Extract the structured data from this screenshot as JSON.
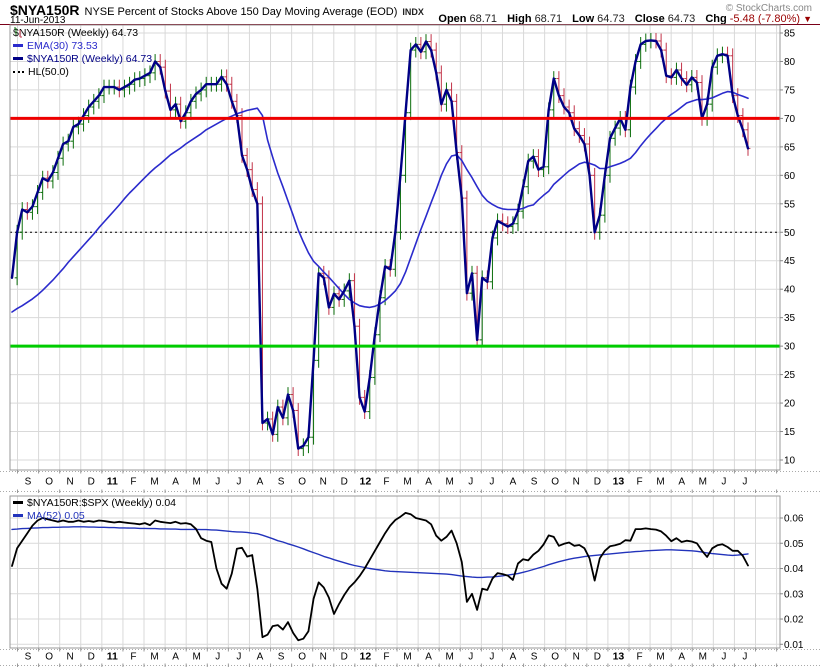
{
  "header": {
    "symbol": "$NYA150R",
    "description": "NYSE Percent of Stocks Above 150 Day Moving Average (EOD)",
    "index_tag": "INDX",
    "date": "11-Jun-2013",
    "copyright": "© StockCharts.com",
    "quote": {
      "open_label": "Open",
      "open": "68.71",
      "high_label": "High",
      "high": "68.71",
      "low_label": "Low",
      "low": "64.73",
      "close_label": "Close",
      "close": "64.73",
      "chg_label": "Chg",
      "chg": "-5.48 (-7.80%)",
      "chg_arrow": "▼"
    }
  },
  "legend_main": {
    "line1": "$NYA150R (Weekly) 64.73",
    "line2": "EMA(30) 73.53",
    "line3": "$NYA150R (Weekly) 64.73",
    "line4": "HL(50.0)"
  },
  "legend_indicator": {
    "line1": "$NYA150R:$SPX (Weekly) 0.04",
    "line2": "MA(52) 0.05"
  },
  "colors": {
    "grid": "#d9d9d9",
    "frame": "#999999",
    "axis_tick": "#888888",
    "red_hline": "#ee0000",
    "green_hline": "#00cc00",
    "hl_dashed": "#000000",
    "close_line": "#000085",
    "ema_line": "#2b2bcc",
    "bar_up": "#0b6e0b",
    "bar_down": "#c23348",
    "ratio_line": "#000000",
    "ma_line": "#2233bb",
    "strip_dots": "#aaaaaa"
  },
  "chart_data": [
    {
      "type": "line",
      "panel": "main",
      "title": "$NYA150R (Weekly)",
      "x_months": [
        "S",
        "O",
        "N",
        "D",
        "11",
        "F",
        "M",
        "A",
        "M",
        "J",
        "J",
        "A",
        "S",
        "O",
        "N",
        "D",
        "12",
        "F",
        "M",
        "A",
        "M",
        "J",
        "J",
        "A",
        "S",
        "O",
        "N",
        "D",
        "13",
        "F",
        "M",
        "A",
        "M",
        "J",
        "J"
      ],
      "ylim": [
        8,
        86.5
      ],
      "yticks": [
        85,
        80,
        75,
        70,
        65,
        60,
        55,
        50,
        45,
        40,
        35,
        30,
        25,
        20,
        15,
        10
      ],
      "grid": true,
      "legend_position": "top-left",
      "hlines": [
        {
          "value": 70,
          "color": "#ee0000",
          "width": 3,
          "style": "solid"
        },
        {
          "value": 50,
          "color": "#000000",
          "width": 1,
          "style": "dashed",
          "name": "HL(50.0)"
        },
        {
          "value": 30,
          "color": "#00cc00",
          "width": 3,
          "style": "solid"
        }
      ],
      "values": {
        "close": [
          42,
          50,
          54,
          53.5,
          54.5,
          57,
          59.5,
          59,
          60.5,
          63,
          65.5,
          66,
          68.5,
          69,
          70.5,
          72,
          73,
          74,
          75.5,
          75.5,
          75.5,
          75,
          75.5,
          76,
          76.8,
          77,
          77.5,
          78,
          80,
          79,
          74.8,
          71.5,
          72.5,
          69.5,
          71,
          73,
          74.3,
          75,
          76,
          76,
          76,
          77.3,
          76,
          73,
          70.5,
          63.5,
          61,
          57.5,
          55,
          16.5,
          17.2,
          14.5,
          19.3,
          17.4,
          21.5,
          18.7,
          12,
          12.5,
          14,
          27.5,
          42.8,
          42,
          36.8,
          39.2,
          38.2,
          39.7,
          41.5,
          33.5,
          21,
          18.5,
          24.5,
          32,
          38.5,
          44,
          43.5,
          50,
          60,
          71,
          82,
          83,
          81.7,
          83.5,
          82,
          78,
          72.5,
          75,
          73,
          64,
          56,
          39.3,
          42.8,
          31.1,
          42,
          41.3,
          49,
          52,
          51.5,
          51,
          51.5,
          53.7,
          58,
          62.5,
          63.3,
          61,
          61.5,
          71.5,
          77,
          74,
          72,
          71,
          68.2,
          67,
          65.5,
          60,
          50,
          53,
          60,
          66.5,
          68.3,
          70,
          68,
          75.5,
          80,
          83,
          83.6,
          83.7,
          83.6,
          82,
          77.5,
          77.2,
          78.5,
          77,
          75.9,
          77.2,
          76.3,
          70,
          72.5,
          79,
          81,
          81.3,
          81,
          74,
          70.5,
          68,
          64.73
        ],
        "ema30": [
          36,
          36.6,
          37.1,
          37.7,
          38.3,
          39,
          39.8,
          40.7,
          41.6,
          42.6,
          43.6,
          44.7,
          45.7,
          46.7,
          47.7,
          48.7,
          49.7,
          50.8,
          51.8,
          52.8,
          53.8,
          54.8,
          55.9,
          56.9,
          57.8,
          58.7,
          59.6,
          60.5,
          61.3,
          62,
          62.8,
          63.6,
          64.2,
          64.8,
          65.5,
          66.1,
          66.7,
          67.3,
          68,
          68.5,
          69,
          69.5,
          70,
          70.4,
          70.8,
          71.1,
          71.4,
          71.6,
          71.8,
          70.5,
          66.2,
          63.2,
          60.4,
          58,
          55.5,
          53,
          50.4,
          48.3,
          46.4,
          44.9,
          44,
          43,
          42.1,
          41.1,
          40.1,
          39.1,
          38.2,
          37.6,
          37.1,
          36.9,
          36.8,
          37,
          37.4,
          38,
          38.8,
          39.7,
          41,
          43,
          45.5,
          48,
          50.5,
          52.8,
          55.2,
          57.5,
          60,
          62,
          63.4,
          63.6,
          62.6,
          61,
          59.6,
          58,
          56.5,
          55.5,
          54.9,
          54.4,
          54.1,
          54,
          54,
          54,
          54.2,
          54.6,
          54.8,
          55.7,
          56.5,
          57.2,
          58.4,
          59.2,
          60,
          60.8,
          61.4,
          62,
          62.3,
          62.1,
          61.8,
          61.2,
          61.2,
          61.5,
          61.8,
          62.1,
          62.5,
          63,
          64,
          65.2,
          66.3,
          67.3,
          68.2,
          69.2,
          70,
          70.7,
          71.3,
          72,
          72.7,
          73,
          73.3,
          73.3,
          73.4,
          73.6,
          74,
          74.4,
          74.7,
          74.6,
          74.2,
          73.9,
          73.53
        ]
      },
      "series": [
        {
          "name": "$NYA150R (Weekly)",
          "last": 64.73,
          "type": "ohlc-bars",
          "data": "close"
        },
        {
          "name": "EMA(30)",
          "last": 73.53,
          "type": "line",
          "data": "ema30",
          "color": "#2b2bcc",
          "width": 1.6
        },
        {
          "name": "$NYA150R (Weekly)",
          "last": 64.73,
          "type": "line",
          "data": "close",
          "color": "#000085",
          "width": 2.4
        }
      ]
    },
    {
      "type": "line",
      "panel": "indicator",
      "title": "$NYA150R:$SPX (Weekly)",
      "x_months": [
        "S",
        "O",
        "N",
        "D",
        "11",
        "F",
        "M",
        "A",
        "M",
        "J",
        "J",
        "A",
        "S",
        "O",
        "N",
        "D",
        "12",
        "F",
        "M",
        "A",
        "M",
        "J",
        "J",
        "A",
        "S",
        "O",
        "N",
        "D",
        "13",
        "F",
        "M",
        "A",
        "M",
        "J",
        "J"
      ],
      "ylim": [
        0.0085,
        0.0685
      ],
      "yticks": [
        0.06,
        0.05,
        0.04,
        0.03,
        0.02,
        0.01
      ],
      "grid": true,
      "legend_position": "top-left",
      "values": {
        "ratio": [
          0.041,
          0.048,
          0.051,
          0.054,
          0.057,
          0.059,
          0.06,
          0.0595,
          0.059,
          0.0585,
          0.059,
          0.0585,
          0.0585,
          0.059,
          0.0585,
          0.0588,
          0.0585,
          0.059,
          0.0588,
          0.0585,
          0.0582,
          0.0585,
          0.0582,
          0.058,
          0.0578,
          0.0575,
          0.058,
          0.0572,
          0.059,
          0.0585,
          0.0582,
          0.058,
          0.0585,
          0.0578,
          0.058,
          0.0575,
          0.0557,
          0.052,
          0.051,
          0.0505,
          0.04,
          0.034,
          0.032,
          0.038,
          0.0478,
          0.0482,
          0.0447,
          0.0453,
          0.032,
          0.0128,
          0.0138,
          0.0172,
          0.0176,
          0.0158,
          0.0188,
          0.0145,
          0.0116,
          0.0122,
          0.0152,
          0.028,
          0.0345,
          0.0325,
          0.0285,
          0.022,
          0.026,
          0.0295,
          0.0325,
          0.0345,
          0.037,
          0.04,
          0.0435,
          0.047,
          0.0505,
          0.054,
          0.057,
          0.0592,
          0.0605,
          0.062,
          0.0615,
          0.06,
          0.0595,
          0.059,
          0.0575,
          0.053,
          0.051,
          0.0525,
          0.055,
          0.05,
          0.0426,
          0.0268,
          0.03,
          0.0236,
          0.032,
          0.0315,
          0.036,
          0.0382,
          0.0378,
          0.0372,
          0.0355,
          0.042,
          0.0437,
          0.0432,
          0.0455,
          0.047,
          0.0495,
          0.0531,
          0.0525,
          0.049,
          0.0498,
          0.0503,
          0.049,
          0.0493,
          0.048,
          0.044,
          0.0352,
          0.044,
          0.047,
          0.0488,
          0.0492,
          0.0498,
          0.0512,
          0.051,
          0.0556,
          0.0556,
          0.0559,
          0.0556,
          0.0554,
          0.0547,
          0.053,
          0.0508,
          0.052,
          0.0505,
          0.051,
          0.0507,
          0.05,
          0.047,
          0.0446,
          0.048,
          0.0492,
          0.0496,
          0.0485,
          0.047,
          0.047,
          0.045,
          0.0412
        ],
        "ma52": [
          0.0555,
          0.0556,
          0.0558,
          0.0559,
          0.056,
          0.0561,
          0.0562,
          0.0562,
          0.0563,
          0.0563,
          0.0564,
          0.0564,
          0.0565,
          0.0565,
          0.0565,
          0.0564,
          0.0564,
          0.0563,
          0.0563,
          0.0562,
          0.0562,
          0.0561,
          0.0561,
          0.056,
          0.056,
          0.0559,
          0.0559,
          0.0558,
          0.0558,
          0.0557,
          0.0557,
          0.0556,
          0.0556,
          0.0555,
          0.0555,
          0.0555,
          0.0555,
          0.0554,
          0.0554,
          0.0553,
          0.0552,
          0.055,
          0.0548,
          0.0546,
          0.0545,
          0.0544,
          0.0543,
          0.054,
          0.0538,
          0.0532,
          0.0525,
          0.0518,
          0.051,
          0.0505,
          0.0498,
          0.0492,
          0.0485,
          0.0478,
          0.047,
          0.0463,
          0.0456,
          0.0448,
          0.0442,
          0.0435,
          0.0429,
          0.0423,
          0.0417,
          0.0412,
          0.0408,
          0.0404,
          0.04,
          0.0397,
          0.0394,
          0.0391,
          0.0389,
          0.0388,
          0.0387,
          0.0386,
          0.0385,
          0.0384,
          0.0383,
          0.0382,
          0.0381,
          0.038,
          0.0379,
          0.0378,
          0.0376,
          0.0373,
          0.037,
          0.0368,
          0.0366,
          0.0365,
          0.0365,
          0.0366,
          0.0367,
          0.0369,
          0.0371,
          0.0374,
          0.0377,
          0.038,
          0.0385,
          0.039,
          0.0396,
          0.0402,
          0.0408,
          0.0415,
          0.0421,
          0.0427,
          0.0432,
          0.0437,
          0.0441,
          0.0444,
          0.0447,
          0.045,
          0.0452,
          0.0454,
          0.0456,
          0.0458,
          0.046,
          0.0462,
          0.0464,
          0.0465,
          0.0467,
          0.0468,
          0.047,
          0.0471,
          0.0472,
          0.0473,
          0.0474,
          0.0474,
          0.0473,
          0.0472,
          0.0471,
          0.047,
          0.0468,
          0.0465,
          0.0462,
          0.0459,
          0.0457,
          0.0455,
          0.0453,
          0.0452,
          0.0453,
          0.0455,
          0.0458
        ]
      },
      "series": [
        {
          "name": "$NYA150R:$SPX (Weekly)",
          "last": 0.04,
          "type": "line",
          "data": "ratio",
          "color": "#000000",
          "width": 1.8
        },
        {
          "name": "MA(52)",
          "last": 0.05,
          "type": "line",
          "data": "ma52",
          "color": "#2233bb",
          "width": 1.4
        }
      ]
    }
  ]
}
